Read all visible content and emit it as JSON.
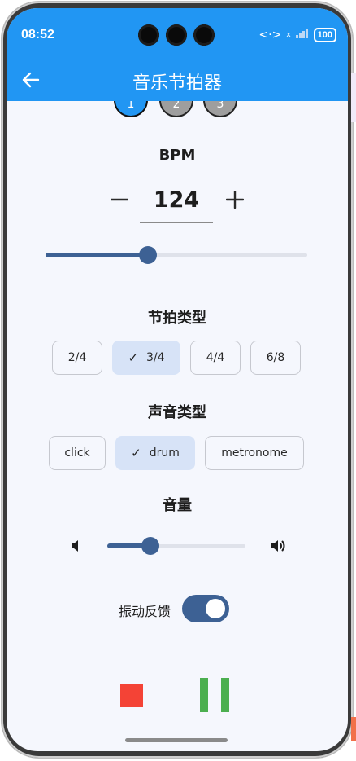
{
  "status_bar": {
    "time": "08:52",
    "battery": "100",
    "signal_text": "<·>",
    "extra": "x"
  },
  "app_bar": {
    "title": "音乐节拍器"
  },
  "steps": [
    "1",
    "2",
    "3"
  ],
  "bpm": {
    "label": "BPM",
    "value": "124",
    "minus": "−",
    "plus": "+",
    "slider_fraction": 0.39
  },
  "time_signature": {
    "label": "节拍类型",
    "options": [
      "2/4",
      "3/4",
      "4/4",
      "6/8"
    ],
    "selected": "3/4"
  },
  "sound_type": {
    "label": "声音类型",
    "options": [
      "click",
      "drum",
      "metronome"
    ],
    "selected": "drum"
  },
  "volume": {
    "label": "音量",
    "slider_fraction": 0.31
  },
  "vibration": {
    "label": "振动反馈",
    "enabled": true
  },
  "colors": {
    "primary": "#2196f3",
    "accent": "#3d6194",
    "stop": "#f44336",
    "pause": "#4caf50",
    "chip_selected": "#d7e3f7"
  }
}
